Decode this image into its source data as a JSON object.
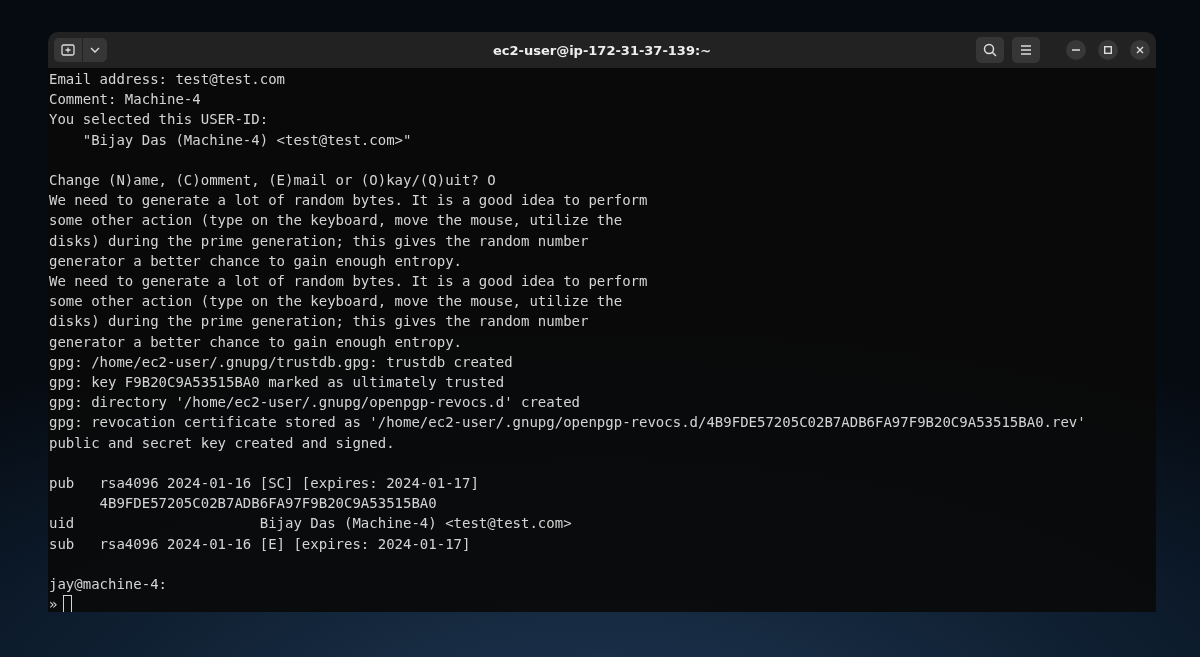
{
  "window": {
    "title": "ec2-user@ip-172-31-37-139:~"
  },
  "terminal": {
    "blocks": [
      [
        "Email address: test@test.com",
        "Comment: Machine-4",
        "You selected this USER-ID:",
        "    \"Bijay Das (Machine-4) <test@test.com>\""
      ],
      [
        "Change (N)ame, (C)omment, (E)mail or (O)kay/(Q)uit? O",
        "We need to generate a lot of random bytes. It is a good idea to perform",
        "some other action (type on the keyboard, move the mouse, utilize the",
        "disks) during the prime generation; this gives the random number",
        "generator a better chance to gain enough entropy.",
        "We need to generate a lot of random bytes. It is a good idea to perform",
        "some other action (type on the keyboard, move the mouse, utilize the",
        "disks) during the prime generation; this gives the random number",
        "generator a better chance to gain enough entropy.",
        "gpg: /home/ec2-user/.gnupg/trustdb.gpg: trustdb created",
        "gpg: key F9B20C9A53515BA0 marked as ultimately trusted",
        "gpg: directory '/home/ec2-user/.gnupg/openpgp-revocs.d' created",
        "gpg: revocation certificate stored as '/home/ec2-user/.gnupg/openpgp-revocs.d/4B9FDE57205C02B7ADB6FA97F9B20C9A53515BA0.rev'",
        "public and secret key created and signed."
      ],
      [
        "pub   rsa4096 2024-01-16 [SC] [expires: 2024-01-17]",
        "      4B9FDE57205C02B7ADB6FA97F9B20C9A53515BA0",
        "uid                      Bijay Das (Machine-4) <test@test.com>",
        "sub   rsa4096 2024-01-16 [E] [expires: 2024-01-17]"
      ],
      [
        "jay@machine-4:"
      ]
    ],
    "prompt": "»"
  }
}
